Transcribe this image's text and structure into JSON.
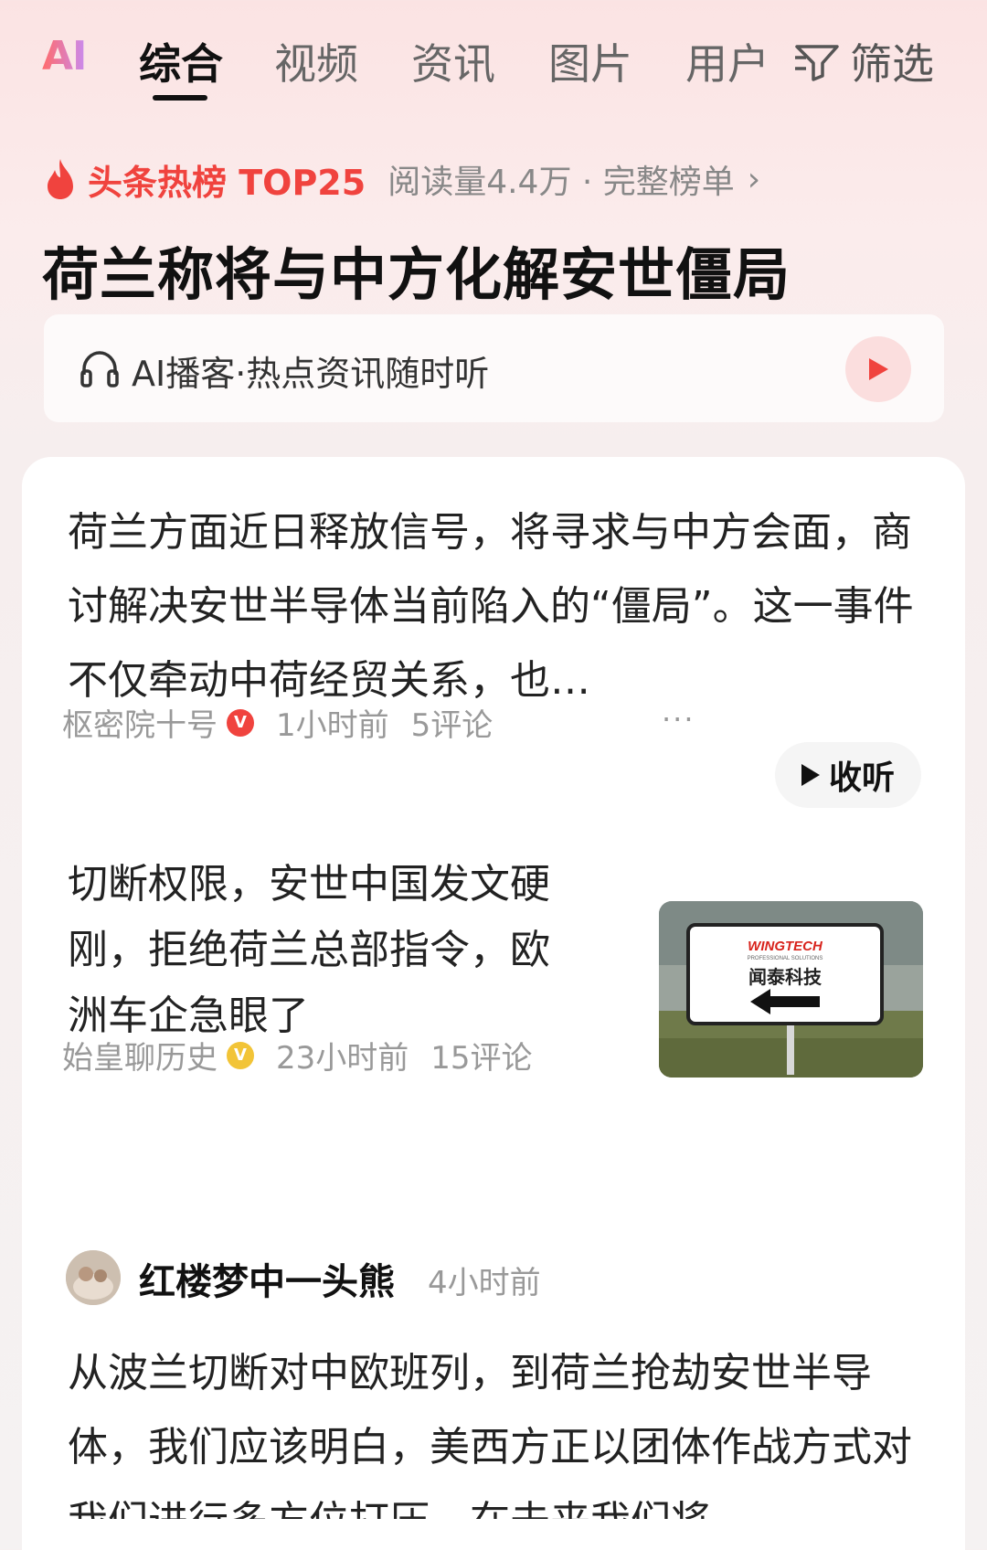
{
  "tabs": {
    "ai_logo": "AI",
    "items": [
      "综合",
      "视频",
      "资讯",
      "图片",
      "用户"
    ],
    "filter": "筛选"
  },
  "hot": {
    "title": "头条热榜 TOP25",
    "meta": "阅读量4.4万 · 完整榜单",
    "headline": "荷兰称将与中方化解安世僵局"
  },
  "podcast": {
    "label": "AI播客·热点资讯随时听"
  },
  "articles": [
    {
      "text": "荷兰方面近日释放信号，将寻求与中方会面，商讨解决安世半导体当前陷入的“僵局”。这一事件不仅牵动中荷经贸关系，也…",
      "author": "枢密院十号",
      "time": "1小时前",
      "comments": "5评论",
      "more": "···",
      "listen": "收听"
    },
    {
      "text": "切断权限，安世中国发文硬刚，拒绝荷兰总部指令，欧洲车企急眼了",
      "author": "始皇聊历史",
      "time": "23小时前",
      "comments": "15评论",
      "thumb_brand": "WINGTECH",
      "thumb_sub": "PROFESSIONAL SOLUTIONS",
      "thumb_cn": "闻泰科技"
    },
    {
      "author": "红楼梦中一头熊",
      "time": "4小时前",
      "text": "从波兰切断对中欧班列，到荷兰抢劫安世半导体，我们应该明白，美西方正以团体作战方式对我们进行多方位打压，在未来我们将"
    }
  ],
  "colors": {
    "accent": "#f0433e",
    "verified_red": "#f0433e",
    "verified_gold": "#f2c437"
  }
}
